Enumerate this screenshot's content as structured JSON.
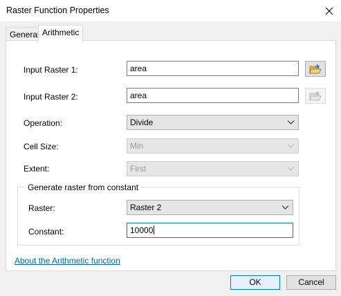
{
  "window": {
    "title": "Raster Function Properties"
  },
  "tabs": [
    {
      "label": "General",
      "active": false
    },
    {
      "label": "Arithmetic",
      "active": true
    }
  ],
  "form": {
    "input_raster_1": {
      "label": "Input Raster 1:",
      "value": "area"
    },
    "input_raster_2": {
      "label": "Input Raster 2:",
      "value": "area"
    },
    "operation": {
      "label": "Operation:",
      "value": "Divide"
    },
    "cell_size": {
      "label": "Cell Size:",
      "value": "Min",
      "enabled": false
    },
    "extent": {
      "label": "Extent:",
      "value": "First",
      "enabled": false
    }
  },
  "constant_group": {
    "title": "Generate raster from constant",
    "raster": {
      "label": "Raster:",
      "value": "Raster 2"
    },
    "constant": {
      "label": "Constant:",
      "value": "10000"
    }
  },
  "help_link": "About the Arithmetic function",
  "buttons": {
    "ok": "OK",
    "cancel": "Cancel"
  },
  "icons": {
    "close": "close-icon",
    "browse_enabled": "open-folder-icon",
    "browse_disabled": "open-folder-icon"
  },
  "colors": {
    "link": "#0066cc",
    "ok_border": "#0078d7"
  }
}
